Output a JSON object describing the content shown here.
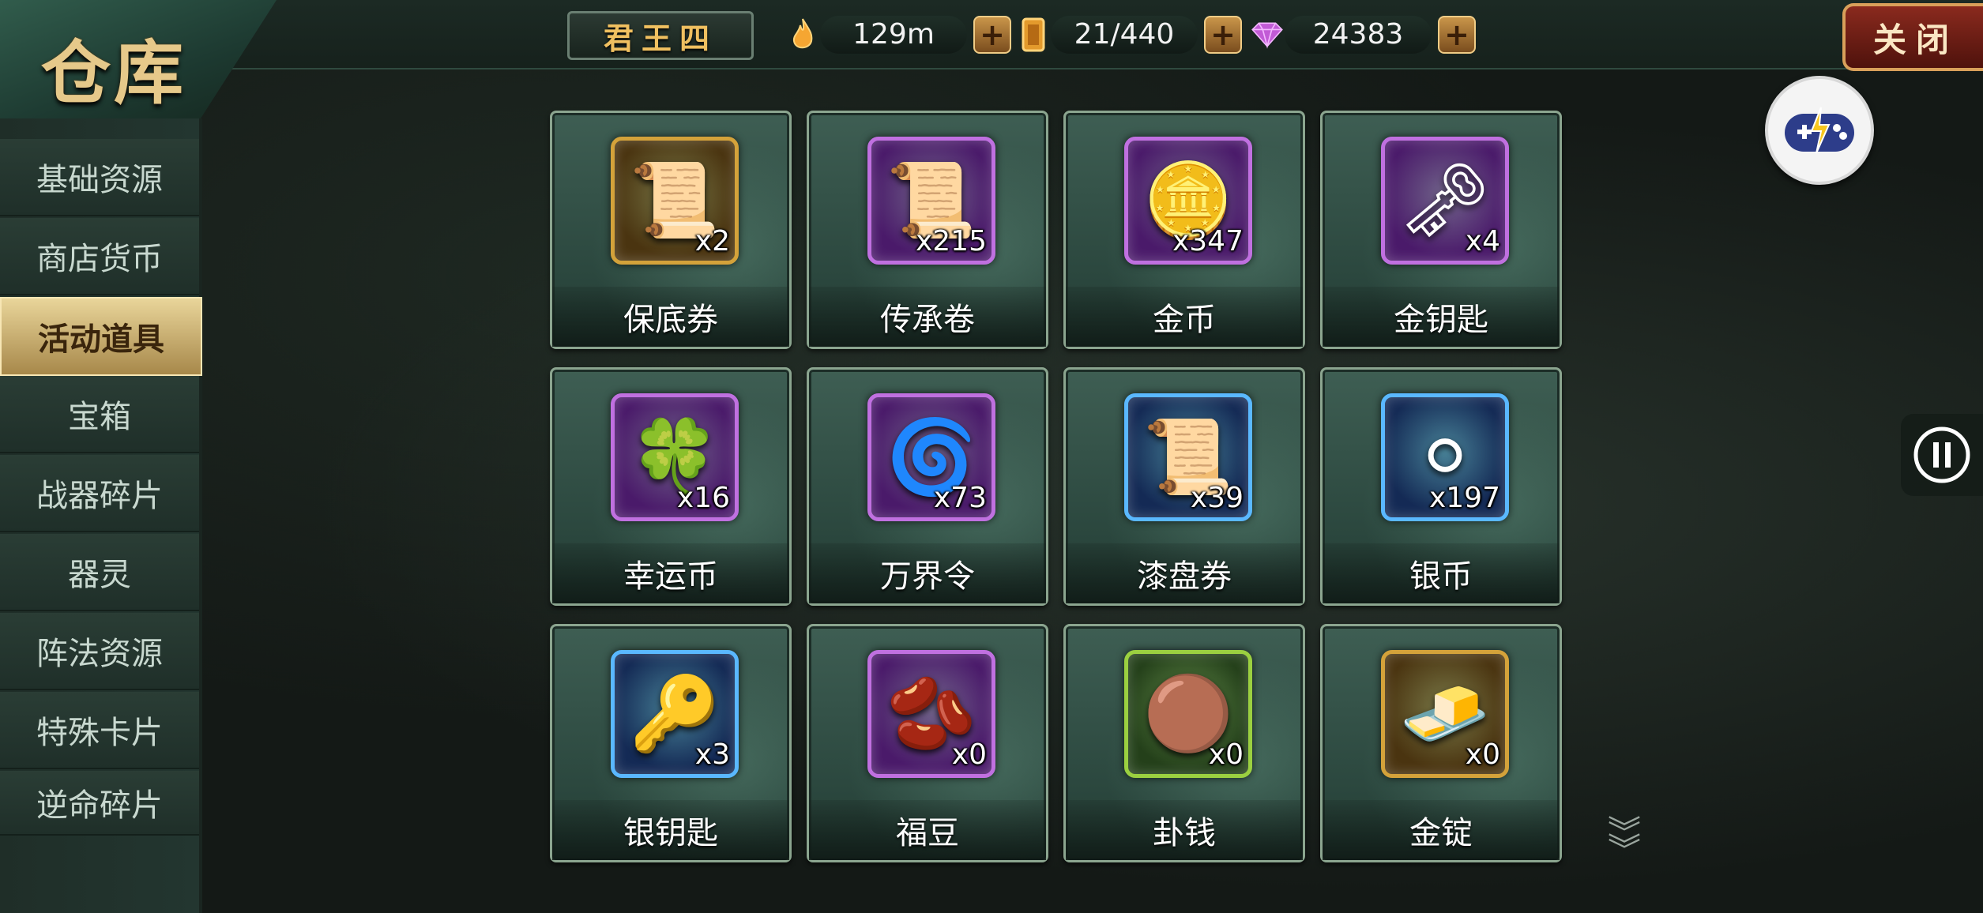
{
  "header": {
    "title": "仓库",
    "server_name": "君王四",
    "close_label": "关闭",
    "resources": [
      {
        "icon": "flame-icon",
        "value": "129m",
        "color": "#f0a030"
      },
      {
        "icon": "token-icon",
        "value": "21/440",
        "color": "#f0b040"
      },
      {
        "icon": "diamond-icon",
        "value": "24383",
        "color": "#c860e0"
      }
    ]
  },
  "sidebar": {
    "items": [
      {
        "label": "基础资源",
        "active": false
      },
      {
        "label": "商店货币",
        "active": false
      },
      {
        "label": "活动道具",
        "active": true
      },
      {
        "label": "宝箱",
        "active": false
      },
      {
        "label": "战器碎片",
        "active": false
      },
      {
        "label": "器灵",
        "active": false
      },
      {
        "label": "阵法资源",
        "active": false
      },
      {
        "label": "特殊卡片",
        "active": false
      },
      {
        "label": "逆命碎片",
        "active": false
      }
    ]
  },
  "items": [
    {
      "name": "保底券",
      "count": "x2",
      "icon": "scroll-icon",
      "glyph": "📜",
      "frame": "gold"
    },
    {
      "name": "传承卷",
      "count": "x215",
      "icon": "inheritance-scroll-icon",
      "glyph": "📜",
      "frame": "purple"
    },
    {
      "name": "金币",
      "count": "x347",
      "icon": "gold-coin-icon",
      "glyph": "🪙",
      "frame": "purple"
    },
    {
      "name": "金钥匙",
      "count": "x4",
      "icon": "gold-key-icon",
      "glyph": "🗝",
      "frame": "purple"
    },
    {
      "name": "幸运币",
      "count": "x16",
      "icon": "lucky-coin-icon",
      "glyph": "🍀",
      "frame": "purple"
    },
    {
      "name": "万界令",
      "count": "x73",
      "icon": "realm-token-icon",
      "glyph": "🌀",
      "frame": "purple"
    },
    {
      "name": "漆盘券",
      "count": "x39",
      "icon": "lacquer-scroll-icon",
      "glyph": "📜",
      "frame": "blue"
    },
    {
      "name": "银币",
      "count": "x197",
      "icon": "silver-coin-icon",
      "glyph": "⚪",
      "frame": "blue"
    },
    {
      "name": "银钥匙",
      "count": "x3",
      "icon": "silver-key-icon",
      "glyph": "🔑",
      "frame": "blue"
    },
    {
      "name": "福豆",
      "count": "x0",
      "icon": "lucky-bean-icon",
      "glyph": "🫘",
      "frame": "purple"
    },
    {
      "name": "卦钱",
      "count": "x0",
      "icon": "copper-coin-icon",
      "glyph": "🟤",
      "frame": "green"
    },
    {
      "name": "金锭",
      "count": "x0",
      "icon": "gold-ingot-icon",
      "glyph": "🧈",
      "frame": "gold"
    }
  ],
  "frame_colors": {
    "gold": {
      "border": "#d4a23a",
      "bg": "#4a3410"
    },
    "purple": {
      "border": "#c070e0",
      "bg": "#4a1a6a"
    },
    "blue": {
      "border": "#5ab8ff",
      "bg": "#142a55"
    },
    "green": {
      "border": "#9bd040",
      "bg": "#24401a"
    }
  }
}
